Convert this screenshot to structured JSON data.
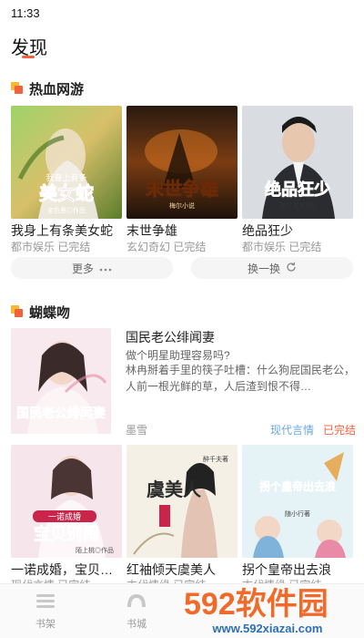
{
  "status": {
    "time": "11:33"
  },
  "page": {
    "title": "发现"
  },
  "section1": {
    "title": "热血网游",
    "books": [
      {
        "title": "我身上有条美女蛇",
        "genre": "都市娱乐",
        "status": "已完结",
        "cover_text": "美女蛇",
        "cover_small": "我身上有条",
        "cover_author": "金色里◎作品"
      },
      {
        "title": "末世争雄",
        "genre": "玄幻奇幻",
        "status": "已完结",
        "cover_text": "末世争雄",
        "cover_author": "梅尔小说"
      },
      {
        "title": "绝品狂少",
        "genre": "都市娱乐",
        "status": "已完结",
        "cover_text": "绝品狂少",
        "cover_author": "善文君子[著]"
      }
    ],
    "more_label": "更多",
    "more_icon": "ellipsis-icon",
    "refresh_label": "换一换",
    "refresh_icon": "refresh-icon"
  },
  "section2": {
    "title": "蝴蝶吻",
    "featured": {
      "title": "国民老公绯闻妻",
      "subtitle": "做个明星助理容易吗?",
      "description": "林冉掰着手里的筷子吐槽：什么狗屁国民老公，人前一根光鲜的草，人后渣到恨不得…",
      "author": "墨雪",
      "genre": "现代言情",
      "status": "已完结",
      "cover_text": "国民老公绯闻妻"
    },
    "books": [
      {
        "title": "一诺成婚，宝贝…",
        "genre": "现代言情",
        "status": "已完结",
        "cover_text": "宝贝别闹",
        "cover_small": "一诺成婚",
        "cover_author": "陌上桃◎作品"
      },
      {
        "title": "红袖倾天虞美人",
        "genre": "古代情缘",
        "status": "已完结",
        "cover_text": "虞美人",
        "cover_small": "红袖倾天",
        "cover_author": "醉千夫著"
      },
      {
        "title": "拐个皇帝出去浪",
        "genre": "古代情缘",
        "status": "已完结",
        "cover_text": "拐个皇帝出去浪",
        "cover_author": "随小行著"
      }
    ]
  },
  "tabbar": {
    "items": [
      {
        "label": "书架",
        "icon": "bookshelf-icon"
      },
      {
        "label": "书城",
        "icon": "bookstore-icon"
      }
    ]
  },
  "watermark": {
    "brand": "592软件园",
    "url": "www.592xiazai.com"
  },
  "colors": {
    "accent": "#f0623c",
    "tag_blue": "#6aa7e3",
    "tag_orange": "#f0623c",
    "muted": "#999999"
  }
}
